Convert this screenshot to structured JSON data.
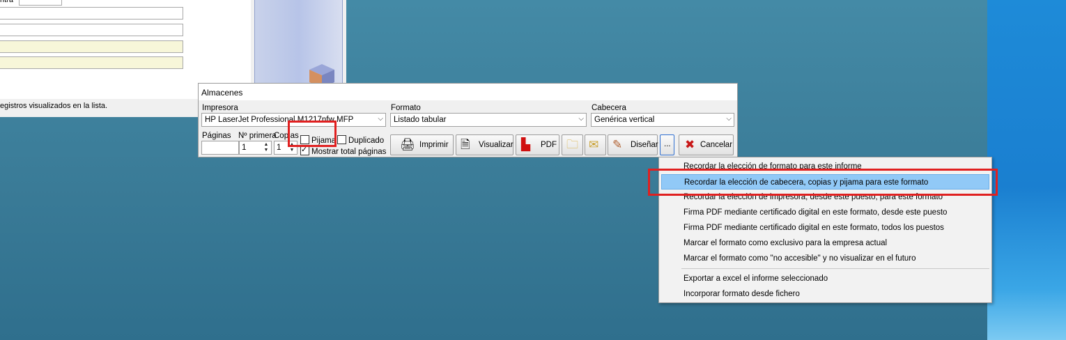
{
  "background_app": {
    "status_text": "egistros visualizados en la lista.",
    "partial_label": "ntra"
  },
  "dialog": {
    "title": "Almacenes",
    "printer_label": "Impresora",
    "printer_value": "HP LaserJet Professional M1217nfw MFP",
    "format_label": "Formato",
    "format_value": "Listado tabular",
    "header_label": "Cabecera",
    "header_value": "Genérica vertical",
    "pages_label": "Páginas",
    "first_num_label": "Nº primera",
    "copies_label": "Copias",
    "first_num_value": "1",
    "copies_value": "1",
    "pijama_label": "Pijama",
    "duplicado_label": "Duplicado",
    "mostrar_label": "Mostrar total páginas",
    "buttons": {
      "imprimir": "Imprimir",
      "visualizar": "Visualizar",
      "pdf": "PDF",
      "disenar": "Diseñar",
      "more": "...",
      "cancelar": "Cancelar"
    }
  },
  "menu": {
    "items": [
      "Recordar la elección de formato para este informe",
      "Recordar la elección de cabecera, copias y pijama para este formato",
      "Recordar la elección de impresora, desde este puesto, para este formato",
      "Firma PDF mediante certificado digital en este formato, desde este puesto",
      "Firma PDF mediante certificado digital en este formato, todos los puestos",
      "Marcar el formato como exclusivo para la empresa actual",
      "Marcar el formato como \"no accesible\" y no visualizar en el futuro",
      "Exportar a excel el informe seleccionado",
      "Incorporar formato desde fichero"
    ]
  },
  "colors": {
    "desktop": "#3d7f9b",
    "highlight": "#91c9f7",
    "annotation": "#e02020"
  }
}
